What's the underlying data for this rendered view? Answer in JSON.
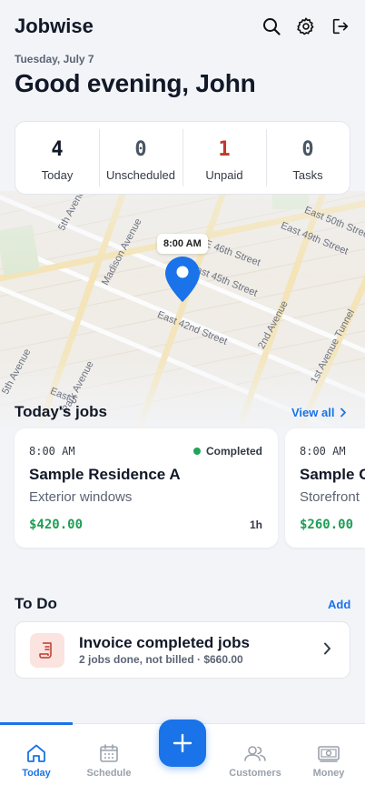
{
  "app": {
    "title": "Jobwise"
  },
  "header": {
    "search_icon": "search-icon",
    "settings_icon": "gear-icon",
    "logout_icon": "logout-icon"
  },
  "date": "Tuesday, July 7",
  "greeting": "Good evening, John",
  "stats": [
    {
      "value": "4",
      "label": "Today",
      "color": "#111827"
    },
    {
      "value": "0",
      "label": "Unscheduled",
      "color": "#4b5563"
    },
    {
      "value": "1",
      "label": "Unpaid",
      "color": "#c0392b"
    },
    {
      "value": "0",
      "label": "Tasks",
      "color": "#4b5563"
    }
  ],
  "map": {
    "pin_time": "8:00 AM",
    "streets": [
      "5th Avenue",
      "Madison Avenue",
      "E 46th Street",
      "East 45th Street",
      "East 42nd Street",
      "2nd Avenue",
      "East 49th Street",
      "East 50th Street",
      "Park Avenue",
      "1st Avenue Tunnel",
      "5th Avenue",
      "East 5"
    ]
  },
  "todays_jobs": {
    "title": "Today's jobs",
    "view_all": "View all",
    "jobs": [
      {
        "time": "8:00 AM",
        "status": "Completed",
        "name": "Sample Residence A",
        "service": "Exterior windows",
        "price": "$420.00",
        "duration": "1h"
      },
      {
        "time": "8:00 AM",
        "status": "",
        "name": "Sample C",
        "service": "Storefront",
        "price": "$260.00",
        "duration": ""
      }
    ]
  },
  "todo": {
    "title": "To Do",
    "add": "Add",
    "items": [
      {
        "title": "Invoice completed jobs",
        "subtitle": "2 jobs done, not billed · $660.00",
        "icon": "invoice-icon"
      }
    ]
  },
  "tabs": [
    {
      "label": "Today",
      "icon": "home-icon",
      "active": true
    },
    {
      "label": "Schedule",
      "icon": "calendar-icon",
      "active": false
    },
    {
      "label": "Customers",
      "icon": "users-icon",
      "active": false
    },
    {
      "label": "Money",
      "icon": "money-icon",
      "active": false
    }
  ],
  "colors": {
    "accent": "#1a73e8",
    "success": "#1e9e55",
    "danger": "#c0392b"
  }
}
